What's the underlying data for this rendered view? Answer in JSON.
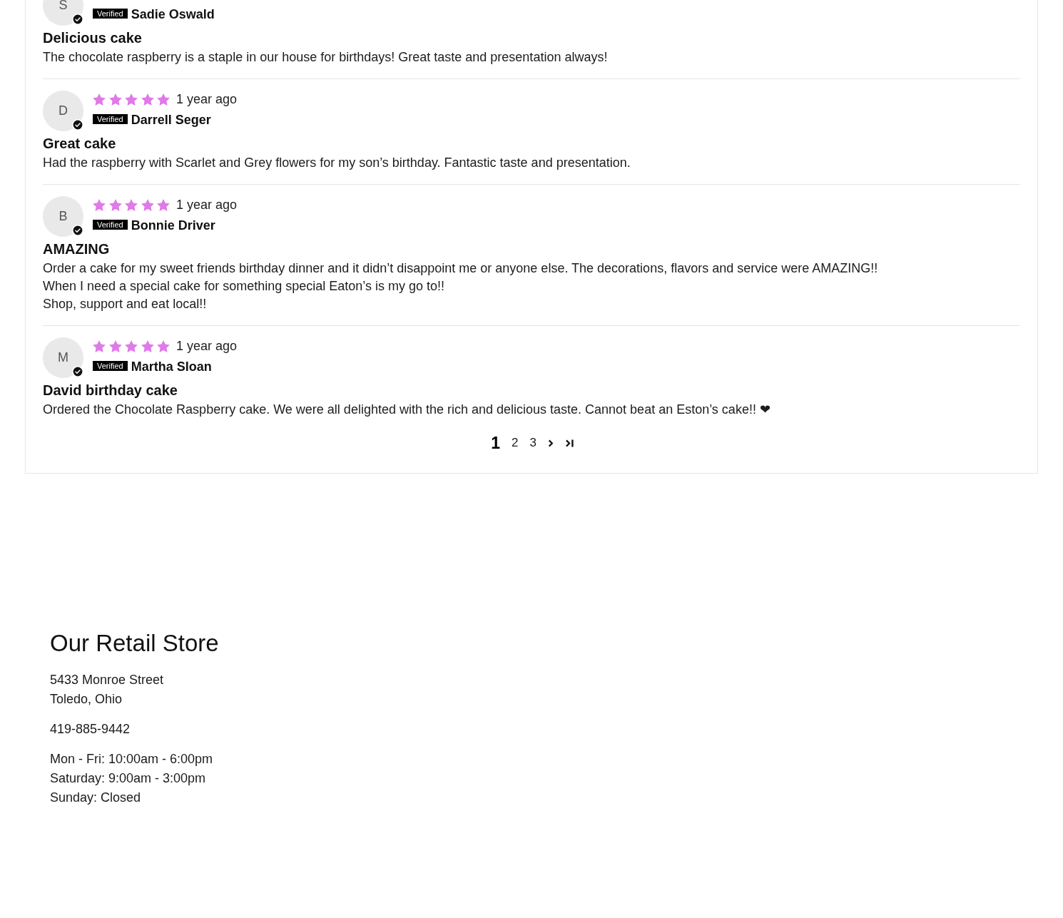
{
  "reviews": {
    "items": [
      {
        "initial": "S",
        "verified": true,
        "badge": "Verified",
        "name": "Sadie Oswald",
        "title": "Delicious cake",
        "body": "The chocolate raspberry is a staple in our house for birthdays! Great taste and presentation always!"
      },
      {
        "initial": "D",
        "stars": 5,
        "date": "1 year ago",
        "verified": true,
        "badge": "Verified",
        "name": "Darrell Seger",
        "title": "Great cake",
        "body": "Had the raspberry with Scarlet and Grey flowers for my son’s birthday. Fantastic taste and presentation."
      },
      {
        "initial": "B",
        "stars": 5,
        "date": "1 year ago",
        "verified": true,
        "badge": "Verified",
        "name": "Bonnie Driver",
        "title": "AMAZING",
        "body": "Order a cake for my sweet friends birthday dinner and it didn’t disappoint me or anyone else. The decorations, flavors and service were AMAZING!!\nWhen I need a special cake for something special Eaton’s is my go to!!\nShop, support and eat local!!"
      },
      {
        "initial": "M",
        "stars": 5,
        "date": "1 year ago",
        "verified": true,
        "badge": "Verified",
        "name": "Martha Sloan",
        "title": "David birthday cake",
        "body": "Ordered the Chocolate Raspberry cake. We were all delighted with the rich and delicious taste. Cannot beat an Eston’s cake!! ❤"
      }
    ],
    "pagination": {
      "pages": [
        {
          "label": "1",
          "selected": true
        },
        {
          "label": "2",
          "selected": false
        },
        {
          "label": "3",
          "selected": false
        }
      ]
    }
  },
  "store": {
    "title": "Our Retail Store",
    "address": [
      "5433 Monroe Street",
      "Toledo, Ohio"
    ],
    "phone": "419-885-9442",
    "hours": [
      "Mon - Fri: 10:00am - 6:00pm",
      "Saturday: 9:00am - 3:00pm",
      "Sunday: Closed"
    ]
  }
}
